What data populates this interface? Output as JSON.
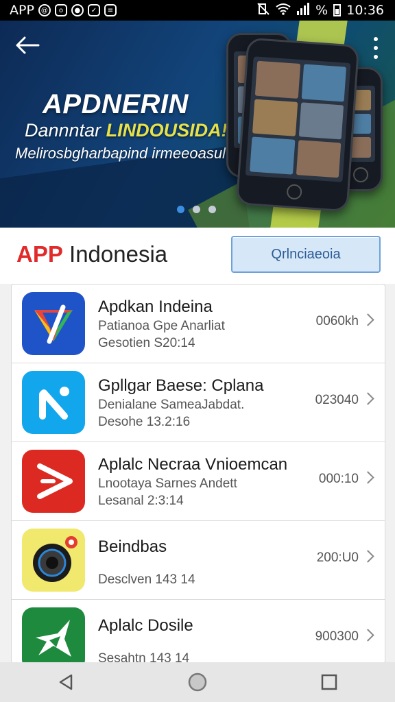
{
  "status_bar": {
    "app_label": "APP",
    "time": "10:36",
    "battery": "%",
    "icons": [
      "mail-icon",
      "app-icon",
      "chat-icon",
      "gallery-icon",
      "download-icon",
      "mute-icon",
      "wifi-icon",
      "signal-icon",
      "battery-icon"
    ]
  },
  "banner": {
    "title": "APDNERIN",
    "subtitle_prefix": "Dannntar",
    "subtitle_highlight": "LINDOUSIDA!",
    "tagline": "Melirosbgharbapind irmeeoasul",
    "slide_count": 3,
    "active_slide": 1
  },
  "header": {
    "brand_app": "APP",
    "brand_rest": "Indonesia",
    "button_label": "Qrlnciaeoia"
  },
  "apps": [
    {
      "name": "Apdkan Indeina",
      "desc": "Patianoa Gpe Anarliat",
      "date": "Gesotien S20:14",
      "size": "0060kh",
      "icon": "google-ads-icon",
      "color": "#1f54c9"
    },
    {
      "name": "Gpllgar Baese: Cplana",
      "desc": "Denialane SameaJabdat.",
      "date": "Desohe 13.2:16",
      "size": "023040",
      "icon": "n-logo-icon",
      "color": "#12a6ec"
    },
    {
      "name": "Aplalc Necraa Vnioemcan",
      "desc": "Lnootaya Sarnes Andett",
      "date": "Lesanal 2:3:14",
      "size": "000:10",
      "icon": "video-play-icon",
      "color": "#dc2a22"
    },
    {
      "name": "Beindbas",
      "desc": "",
      "date": "Desclven 143 14",
      "size": "200:U0",
      "icon": "camera-icon",
      "color": "#f1e86e"
    },
    {
      "name": "Aplalc Dosile",
      "desc": "",
      "date": "Sesahtn 143 14",
      "size": "900300",
      "icon": "star-arrow-icon",
      "color": "#1e8a3e"
    }
  ],
  "nav": {
    "back": "back-triangle-icon",
    "home": "home-circle-icon",
    "recents": "recents-square-icon"
  }
}
